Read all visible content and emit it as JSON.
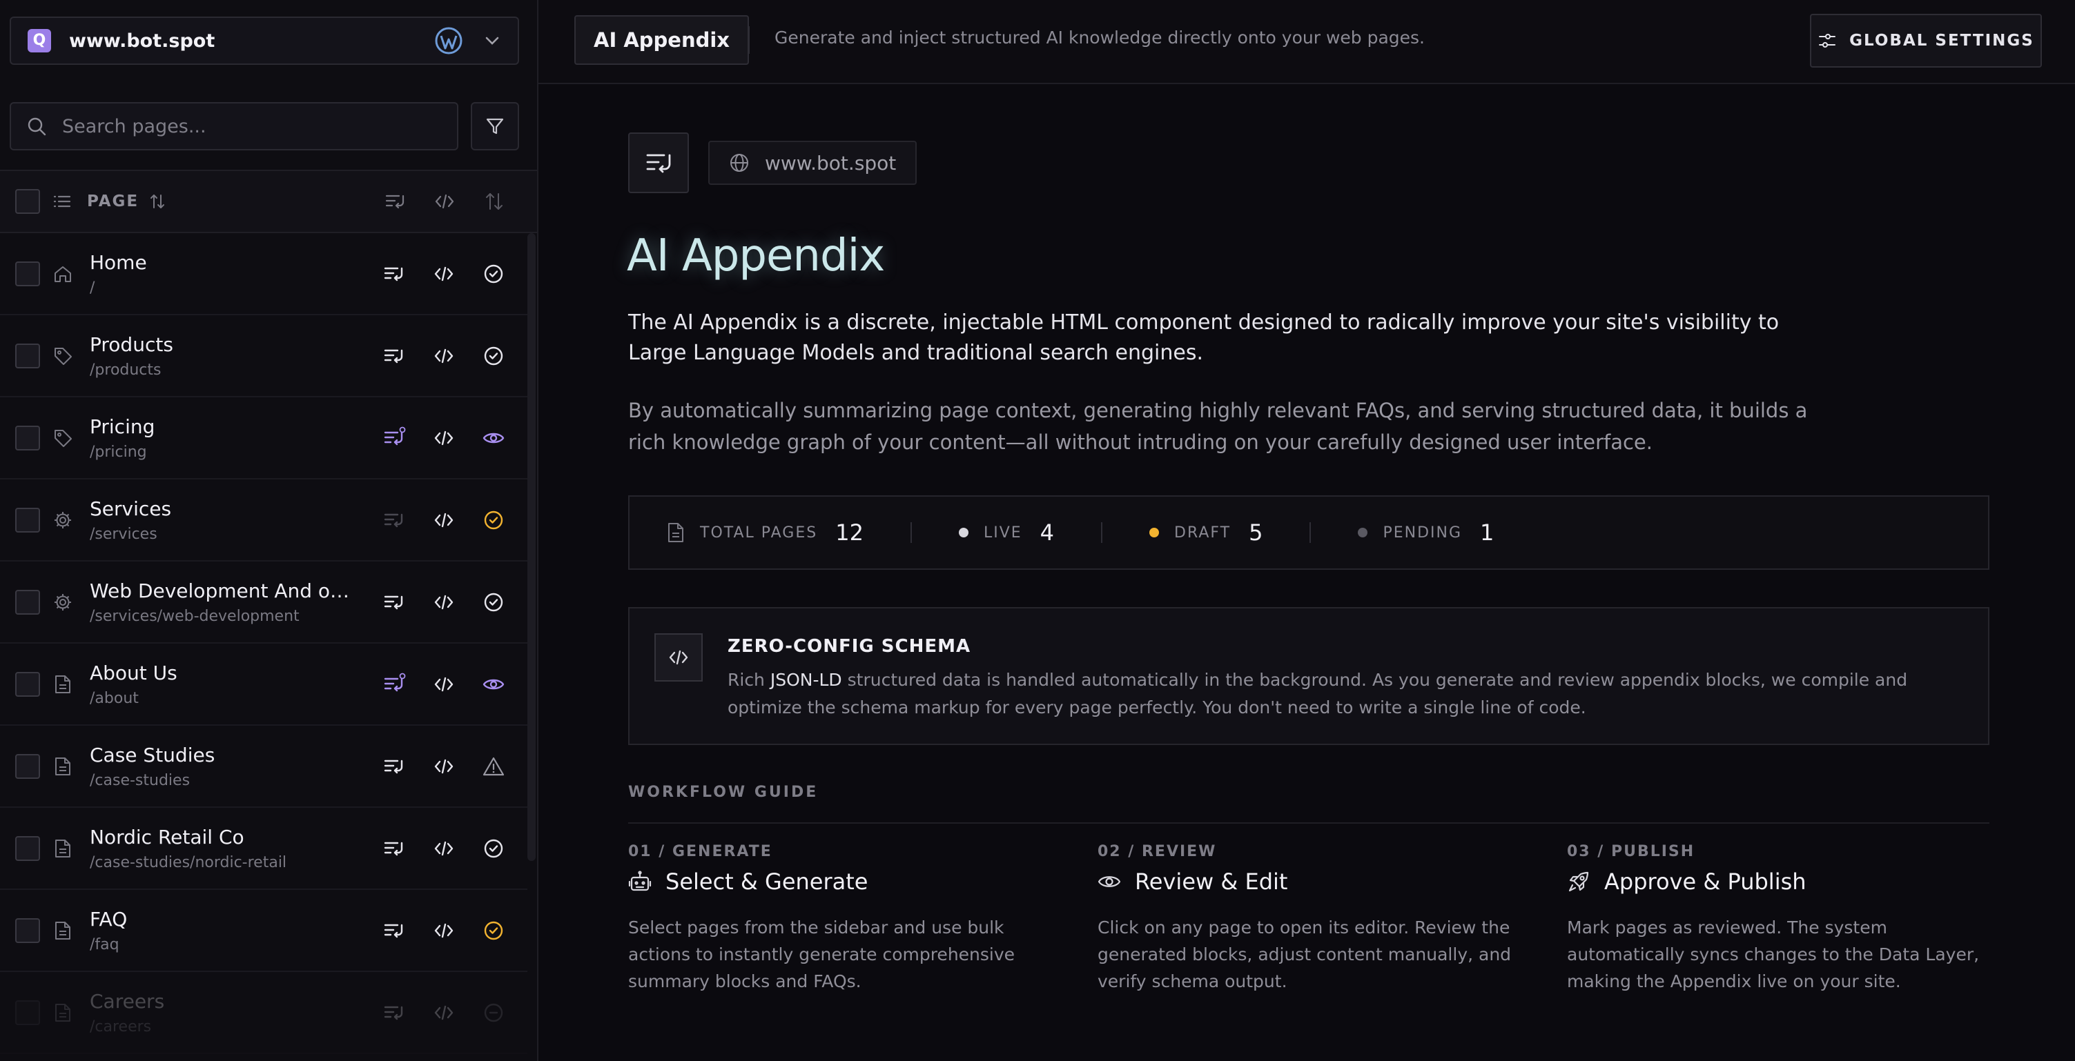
{
  "site": {
    "name": "www.bot.spot",
    "logo_letter": "Q"
  },
  "search": {
    "placeholder": "Search pages..."
  },
  "list_header": {
    "label": "PAGE"
  },
  "pages": [
    {
      "title": "Home",
      "path": "/",
      "type_icon": "home-icon",
      "status": "reviewed"
    },
    {
      "title": "Products",
      "path": "/products",
      "type_icon": "tag-icon",
      "status": "reviewed"
    },
    {
      "title": "Pricing",
      "path": "/pricing",
      "type_icon": "tag-icon",
      "status": "live"
    },
    {
      "title": "Services",
      "path": "/services",
      "type_icon": "gear-icon",
      "status": "draft"
    },
    {
      "title": "Web Development And othe...",
      "path": "/services/web-development",
      "type_icon": "gear-icon",
      "status": "reviewed"
    },
    {
      "title": "About Us",
      "path": "/about",
      "type_icon": "document-icon",
      "status": "live"
    },
    {
      "title": "Case Studies",
      "path": "/case-studies",
      "type_icon": "document-icon",
      "status": "warning"
    },
    {
      "title": "Nordic Retail Co",
      "path": "/case-studies/nordic-retail",
      "type_icon": "document-icon",
      "status": "reviewed"
    },
    {
      "title": "FAQ",
      "path": "/faq",
      "type_icon": "document-icon",
      "status": "draft"
    },
    {
      "title": "Careers",
      "path": "/careers",
      "type_icon": "document-icon",
      "status": "pending"
    }
  ],
  "topbar": {
    "tab_label": "AI Appendix",
    "description": "Generate and inject structured AI knowledge directly onto your web pages.",
    "settings_label": "GLOBAL SETTINGS"
  },
  "main": {
    "domain": "www.bot.spot",
    "title": "AI Appendix",
    "lead": "The AI Appendix is a discrete, injectable HTML component designed to radically improve your site's visibility to Large Language Models and traditional search engines.",
    "sub": "By automatically summarizing page context, generating highly relevant FAQs, and serving structured data, it builds a rich knowledge graph of your content—all without intruding on your carefully designed user interface."
  },
  "stats": {
    "total_label": "TOTAL PAGES",
    "total": "12",
    "live_label": "LIVE",
    "live": "4",
    "draft_label": "DRAFT",
    "draft": "5",
    "pending_label": "PENDING",
    "pending": "1"
  },
  "schema": {
    "title": "ZERO-CONFIG SCHEMA",
    "body_pre": "Rich ",
    "body_highlight": "JSON-LD",
    "body_post": " structured data is handled automatically in the background. As you generate and review appendix blocks, we compile and optimize the schema markup for every page perfectly. You don't need to write a single line of code."
  },
  "workflow": {
    "label": "WORKFLOW GUIDE",
    "steps": [
      {
        "num": "01 / GENERATE",
        "title": "Select & Generate",
        "desc": "Select pages from the sidebar and use bulk actions to instantly generate comprehensive summary blocks and FAQs."
      },
      {
        "num": "02 / REVIEW",
        "title": "Review & Edit",
        "desc": "Click on any page to open its editor. Review the generated blocks, adjust content manually, and verify schema output."
      },
      {
        "num": "03 / PUBLISH",
        "title": "Approve & Publish",
        "desc": "Mark pages as reviewed. The system automatically syncs changes to the Data Layer, making the Appendix live on your site."
      }
    ]
  },
  "colors": {
    "accent_purple": "#a98ff0",
    "draft_amber": "#f2b330",
    "live_white": "#d8d7de",
    "pending_gray": "#5a5962"
  }
}
